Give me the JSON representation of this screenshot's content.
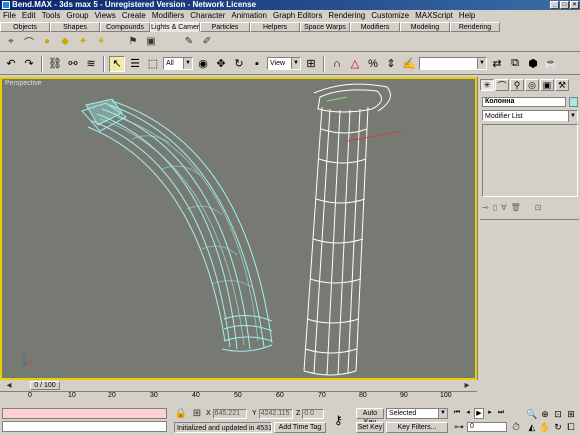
{
  "window": {
    "title": "Bend.MAX - 3ds max 5 - Unregistered Version - Network License"
  },
  "menu": [
    "File",
    "Edit",
    "Tools",
    "Group",
    "Views",
    "Create",
    "Modifiers",
    "Character",
    "Animation",
    "Graph Editors",
    "Rendering",
    "Customize",
    "MAXScript",
    "Help"
  ],
  "tabs": [
    "Objects",
    "Shapes",
    "Compounds",
    "Lights & Cameras",
    "Particles",
    "Helpers",
    "Space Warps",
    "Modifiers",
    "Modeling",
    "Rendering"
  ],
  "toolbar": {
    "selection_filter": "All",
    "ref_coord": "View"
  },
  "viewport": {
    "label": "Perspective"
  },
  "command_panel": {
    "object_name": "Колонна",
    "modifier_list": "Modifier List"
  },
  "timeline": {
    "slider": "0 / 100",
    "ticks": [
      "0",
      "10",
      "20",
      "30",
      "40",
      "50",
      "60",
      "70",
      "80",
      "90",
      "100"
    ]
  },
  "status": {
    "x_label": "X",
    "x_value": "645.221",
    "y_label": "Y",
    "y_value": "4242.115",
    "z_label": "Z",
    "z_value": "0.0",
    "message": "Initialized and updated in 4531 ms",
    "add_time_tag": "Add Time Tag",
    "auto_key": "Auto Key",
    "set_key": "Set Key",
    "selected": "Selected",
    "key_filters": "Key Filters...",
    "frame": "0"
  },
  "colors": {
    "active_tab": "#e8e6e0",
    "viewport_bg": "#777a72",
    "viewport_border": "#e8d000",
    "bent_column": "#9ff0ec",
    "straight_column": "#ffffff"
  }
}
